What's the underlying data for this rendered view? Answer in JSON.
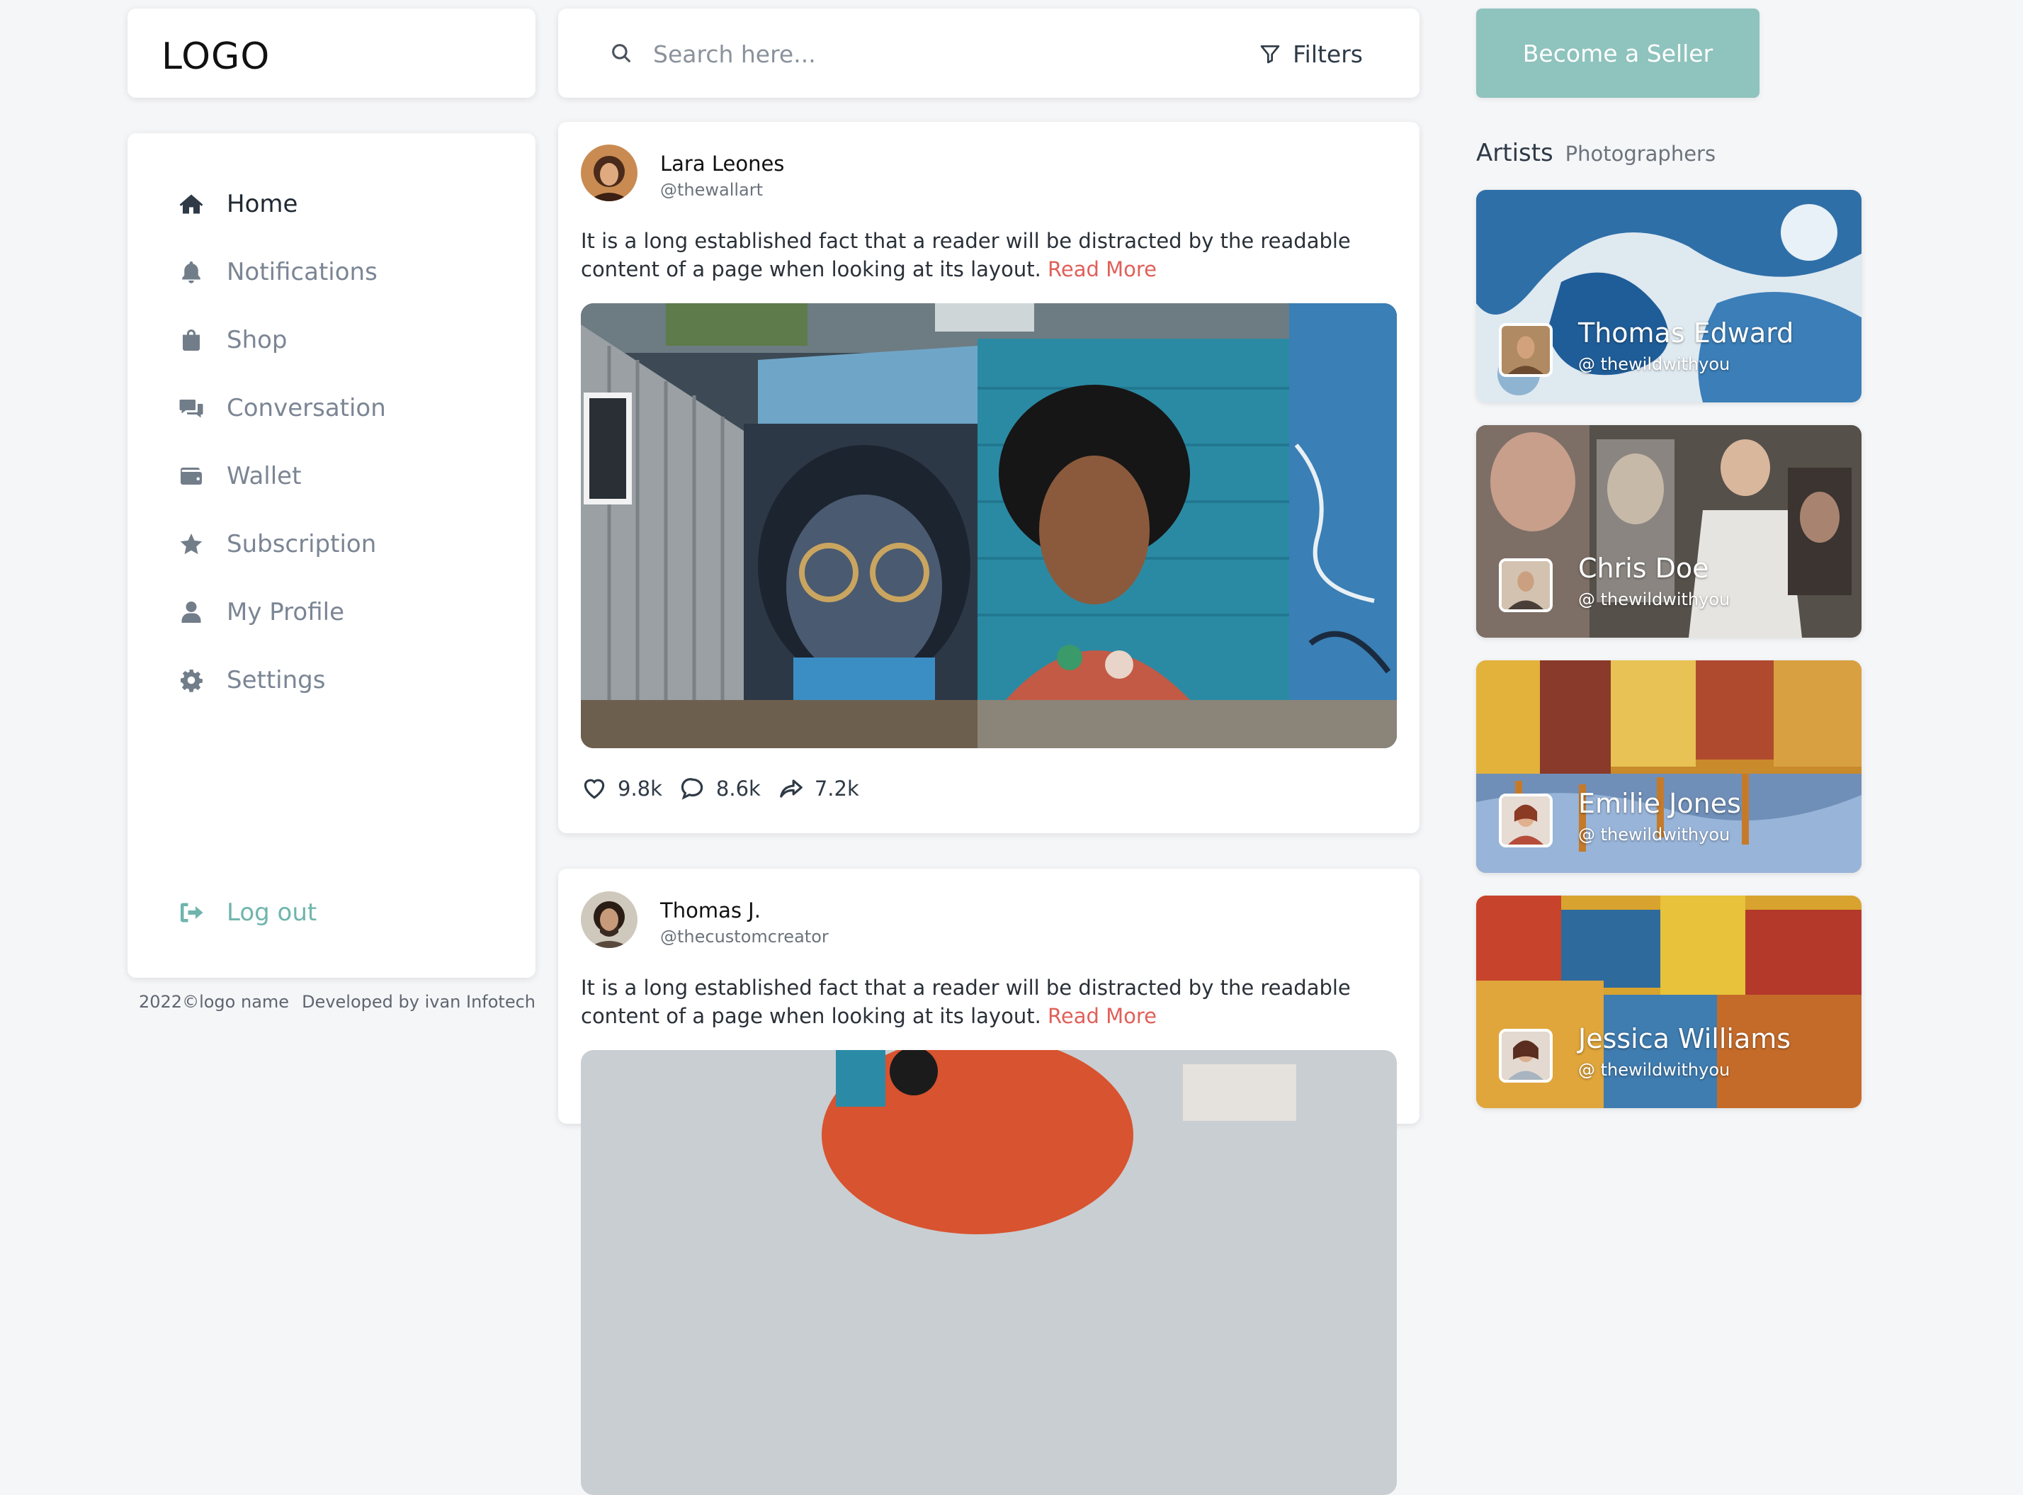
{
  "logo": {
    "text": "LOGO"
  },
  "nav": {
    "items": [
      {
        "label": "Home",
        "icon": "home-icon",
        "active": true
      },
      {
        "label": "Notifications",
        "icon": "bell-icon"
      },
      {
        "label": "Shop",
        "icon": "shopping-bag-icon"
      },
      {
        "label": "Conversation",
        "icon": "chat-icon"
      },
      {
        "label": "Wallet",
        "icon": "wallet-icon"
      },
      {
        "label": "Subscription",
        "icon": "star-icon"
      },
      {
        "label": "My Profile",
        "icon": "user-icon"
      },
      {
        "label": "Settings",
        "icon": "gear-icon"
      }
    ],
    "logout": {
      "label": "Log out",
      "icon": "logout-icon"
    }
  },
  "footer": {
    "copyright": "2022©logo name",
    "developer": "Developed by ivan Infotech"
  },
  "search": {
    "placeholder": "Search here...",
    "value": "",
    "filters_label": "Filters"
  },
  "posts": [
    {
      "author": "Lara Leones",
      "handle": "@thewallart",
      "text": "It is a long established fact that a reader will be distracted by the readable content of a page when looking at its layout.",
      "read_more": "Read More",
      "likes": "9.8k",
      "comments": "8.6k",
      "shares": "7.2k"
    },
    {
      "author": "Thomas J.",
      "handle": "@thecustomcreator",
      "text": "It is a long established fact that a reader will be distracted by the readable content of a page when looking at its layout.",
      "read_more": "Read More"
    }
  ],
  "seller_button": "Become a Seller",
  "artists_section": {
    "title": "Artists",
    "subtitle": "Photographers",
    "artists": [
      {
        "name": "Thomas Edward",
        "handle": "@ thewildwithyou"
      },
      {
        "name": "Chris Doe",
        "handle": "@ thewildwithyou"
      },
      {
        "name": "Emilie Jones",
        "handle": "@ thewildwithyou"
      },
      {
        "name": "Jessica Williams",
        "handle": "@ thewildwithyou"
      }
    ]
  },
  "colors": {
    "accent": "#8fc3bd",
    "logout": "#6fb5ad",
    "read_more": "#e0605a",
    "background": "#f5f6f8"
  }
}
